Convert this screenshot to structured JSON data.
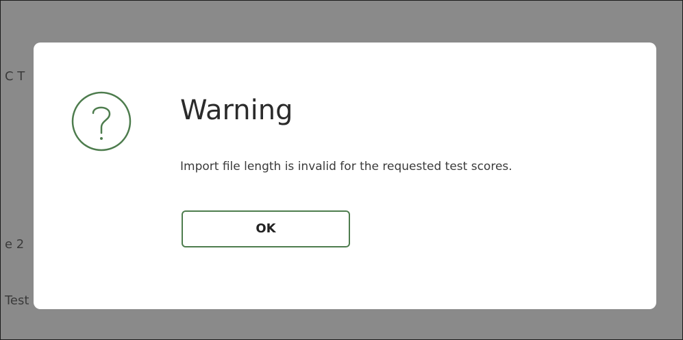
{
  "background": {
    "fragments": [
      "C T",
      "e 2",
      "Test"
    ]
  },
  "dialog": {
    "icon": "question-circle-icon",
    "title": "Warning",
    "message": "Import file length is invalid for the requested test scores.",
    "ok_label": "OK"
  },
  "colors": {
    "overlay": "#8a8a8a",
    "accent_green": "#4d7c4d",
    "dialog_bg": "#ffffff"
  }
}
